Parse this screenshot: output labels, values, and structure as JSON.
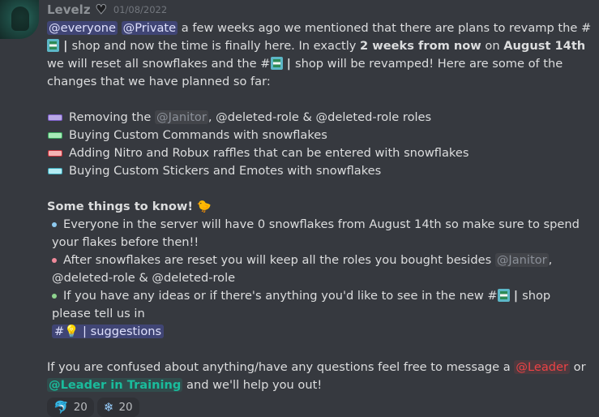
{
  "message": {
    "author": "Levelz",
    "date": "01/08/2022",
    "intro": {
      "mention1": "@everyone",
      "mention2": "@Private",
      "t1": " a few weeks ago we mentioned that there are plans to revamp the #",
      "sep": " | ",
      "t2": "shop and now the time is finally here. In exactly ",
      "bold1": "2 weeks from now",
      "t3": " on ",
      "bold2": "August 14th",
      "t4": " we will reset all snowflakes and the #",
      "t5": "shop will be revamped! Here are some of the changes that we have planned so far:"
    },
    "changes": [
      {
        "pre": "Removing the ",
        "role": "@Janitor",
        "post": ", @deleted-role & @deleted-role roles"
      },
      {
        "text": "Buying Custom Commands with snowflakes"
      },
      {
        "text": "Adding Nitro and Robux raffles that can be entered with snowflakes"
      },
      {
        "text": "Buying Custom Stickers and Emotes with snowflakes"
      }
    ],
    "section_title": "Some things to know!",
    "points": [
      {
        "text": "Everyone in the server will have 0 snowflakes from August 14th so make sure to spend your flakes before then!!"
      },
      {
        "pre": "After snowflakes are reset you will keep all the roles you bought besides ",
        "role": "@Janitor",
        "post": ", @deleted-role & @deleted-role"
      },
      {
        "pre": "If you have any ideas or if there's anything you'd like to see in the new #",
        "post": "shop please tell us in",
        "channel": "#💡 | suggestions"
      }
    ],
    "outro": {
      "t1": "If you are confused about anything/have any questions feel free to message a ",
      "role1": "@Leader",
      "t2": " or ",
      "role2": "@Leader in Training",
      "t3": " and we'll help you out!"
    },
    "reactions": [
      {
        "emoji": "🐬",
        "icon_name": "custom-emoji",
        "count": "20"
      },
      {
        "emoji": "❄",
        "icon_name": "snowflake-icon",
        "count": "20"
      }
    ]
  }
}
